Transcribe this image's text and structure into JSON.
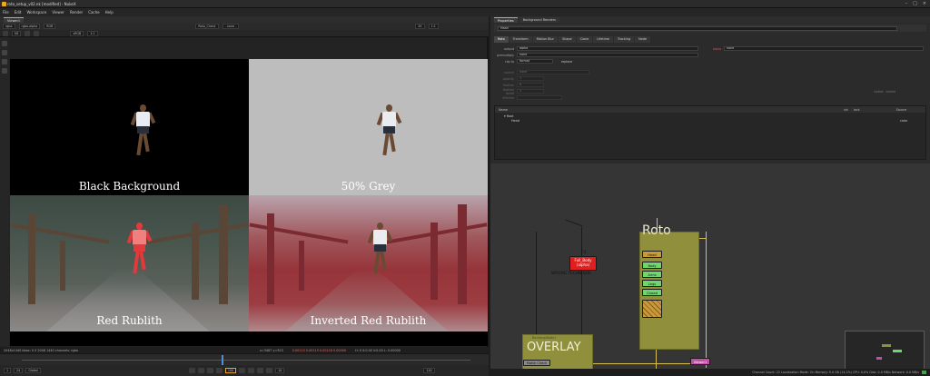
{
  "window": {
    "title": "roto_setup_v02.nk [modified] - NukeX"
  },
  "menu": {
    "items": [
      "File",
      "Edit",
      "Workspace",
      "Viewer",
      "Render",
      "Cache",
      "Help"
    ]
  },
  "viewer": {
    "tab_label": "Viewer1",
    "channels": "rgba",
    "alpha_field": "rgba.alpha",
    "colorspace": "RGB",
    "exposure": "sRGB",
    "frame_field": "1:1",
    "compare_a": "Roto_Check",
    "compare_b": "- none -",
    "zoom": "2K",
    "proxy": "1:1",
    "fstop_label": "f/8",
    "quadrants": [
      {
        "label": "Black Background"
      },
      {
        "label": "50% Grey"
      },
      {
        "label": "Red Rublith"
      },
      {
        "label": "Inverted Red Rublith"
      }
    ],
    "info_left": "2048x1440  bbox: 0 0 2048 1440 channels: rgba",
    "info_xy": "x=3487 y=923",
    "info_values": "0.00113 0.00119 0.00116 0.00000",
    "info_hsv": "H: 0 S:0.00 V:0.00 L: 0.00000",
    "frame_in": "1",
    "frame_out": "120",
    "fps": "24",
    "playback_mode": "Global",
    "current_frame": "100",
    "increment": "10"
  },
  "properties": {
    "tabs": [
      "Properties",
      "Background Renders"
    ],
    "node_name": "Head",
    "subtabs": [
      "Roto",
      "Transform",
      "Motion Blur",
      "Shape",
      "Clone",
      "Lifetime",
      "Tracking",
      "Node"
    ],
    "params": {
      "output_label": "output",
      "output_value": "alpha",
      "premultiply_label": "premultiply",
      "premultiply_value": "none",
      "clip_to_label": "clip to",
      "clip_to_value": "format",
      "replace_label": "replace",
      "alpha_mask_label": "alpha",
      "alpha_mask_value": "none",
      "source_label": "source",
      "source_value": "none",
      "opacity_label": "opacity",
      "opacity_value": "1",
      "feather_label": "feather",
      "feather_value": "0",
      "feather_falloff_label": "feather falloff",
      "feather_falloff_value": "1",
      "lifetime_label": "lifetime",
      "visible_label": "visible",
      "locked_label": "locked"
    },
    "curves": {
      "header_name": "Name",
      "columns": [
        "vis",
        "lock",
        "mb",
        "life",
        "ovl",
        "blend",
        "inv",
        "Source"
      ],
      "root": "Root",
      "item": "Head",
      "source_value": "color"
    }
  },
  "nodegraph": {
    "roto_backdrop": "Roto",
    "overlay_backdrop": "OVERLAY",
    "backdrop_node_small": "BackdropNode1",
    "full_body_node": "Full_Body (alpha)",
    "full_body_top": "F3",
    "wrong_technique": "WRONG TECHNIQUE",
    "nodes": [
      "Head",
      "Body",
      "Arms",
      "Legs",
      "Closed"
    ],
    "matte_check": "Matte Check",
    "viewer_node": "Viewer1"
  },
  "statusbar": {
    "text": "Channel Count: 22  Localization Mode: On  Memory: 9.0 GB (14.2%)  CPU: 0.0%  Disk: 0.0 MB/s  Network: 0.0 MB/s"
  },
  "colors": {
    "accent": "#f0a030",
    "roto_node": "#6fd66f",
    "backdrop": "#8f8f3c",
    "full_body_node": "#e02020",
    "viewer_node": "#c04fa6"
  }
}
